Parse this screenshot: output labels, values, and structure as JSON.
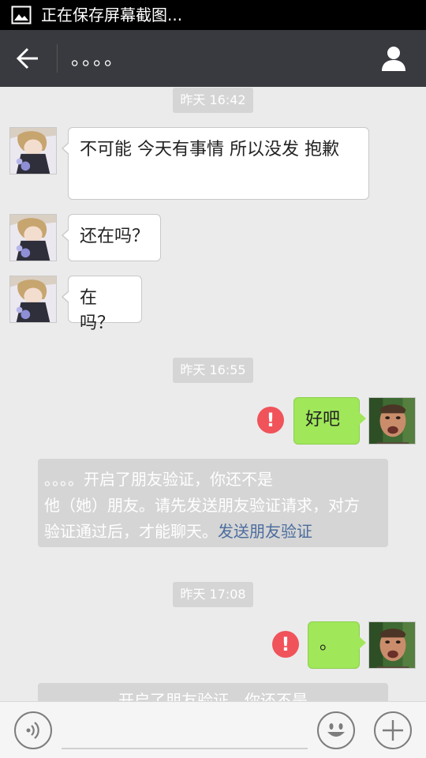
{
  "status_bar": {
    "text": "正在保存屏幕截图..."
  },
  "header": {
    "title": "。。。。"
  },
  "messages": {
    "time1": "昨天 16:42",
    "in1": "不可能  今天有事情  所以没发   抱歉",
    "in2": "还在吗？",
    "in3": "在吗？",
    "time2": "昨天 16:55",
    "out1": "好吧",
    "sys1_line1": "。。。。开启了朋友验证，你还不是",
    "sys1_line2": "他（她）朋友。请先发送朋友验证请求，对方",
    "sys1_line3": "验证通过后，才能聊天。",
    "sys1_link": "发送朋友验证",
    "time3": "昨天 17:08",
    "out2": "。",
    "sys2_partial": "开启了朋友验证，你还不是",
    "error_mark": "!"
  },
  "colors": {
    "title_bar": "#393a3f",
    "chat_bg": "#ebebeb",
    "outgoing_bubble": "#a0e75a",
    "error": "#f0535a",
    "link": "#4c6d9e"
  },
  "icons": {
    "back": "arrow-left-icon",
    "profile": "person-icon",
    "voice": "voice-icon",
    "emoji": "emoji-icon",
    "more": "plus-icon"
  }
}
